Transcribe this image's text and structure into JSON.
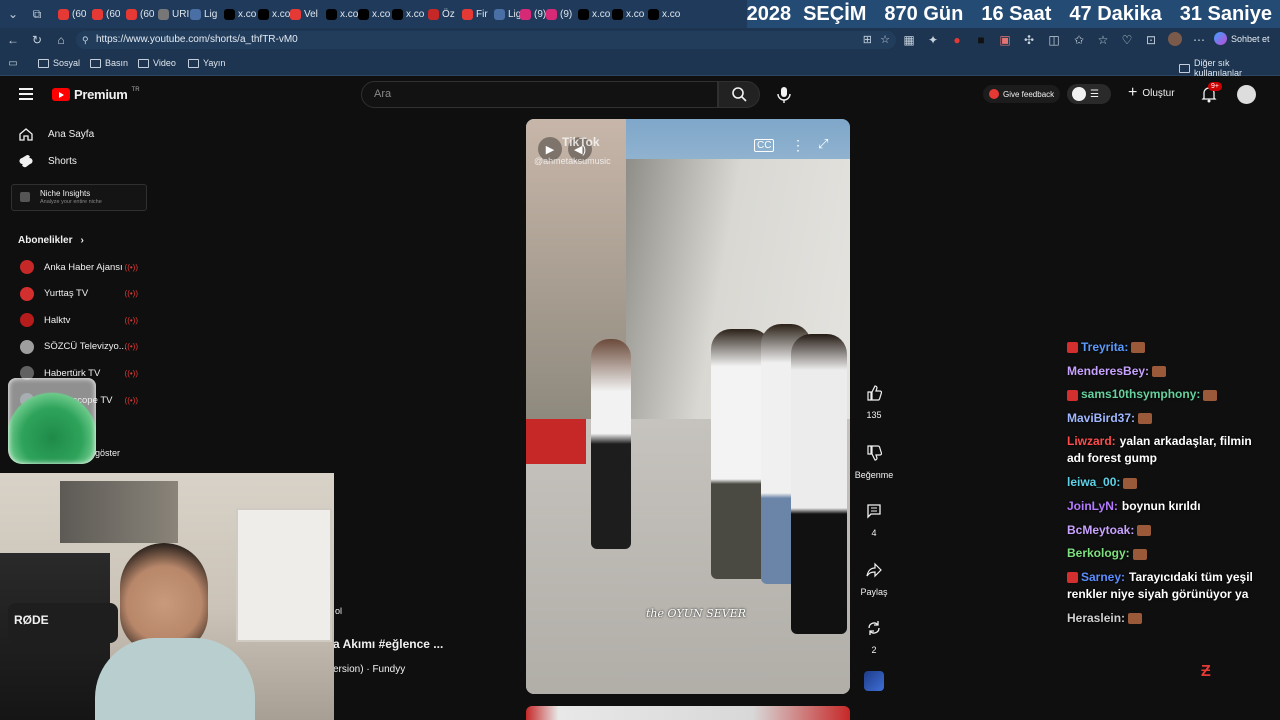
{
  "browser": {
    "tabs": [
      {
        "label": "(60",
        "icon": "youtube-icon",
        "color": "#e53935"
      },
      {
        "label": "(60",
        "icon": "youtube-icon",
        "color": "#e53935"
      },
      {
        "label": "(60",
        "icon": "youtube-icon",
        "color": "#e53935"
      },
      {
        "label": "URI",
        "icon": "generic-icon",
        "color": "#777777"
      },
      {
        "label": "Lig",
        "icon": "slash-icon",
        "color": "#4a6fa5"
      },
      {
        "label": "x.co",
        "icon": "x-icon",
        "color": "#000000"
      },
      {
        "label": "x.co",
        "icon": "x-icon",
        "color": "#000000"
      },
      {
        "label": "Vel",
        "icon": "youtube-icon",
        "color": "#e53935"
      },
      {
        "label": "x.co",
        "icon": "x-icon",
        "color": "#000000"
      },
      {
        "label": "x.co",
        "icon": "x-icon",
        "color": "#000000"
      },
      {
        "label": "x.co",
        "icon": "x-icon",
        "color": "#000000"
      },
      {
        "label": "Öz",
        "icon": "flag-icon",
        "color": "#c62828"
      },
      {
        "label": "Fir",
        "icon": "youtube-icon",
        "color": "#e53935"
      },
      {
        "label": "Lig",
        "icon": "slash-icon",
        "color": "#4a6fa5"
      },
      {
        "label": "(9)",
        "icon": "instagram-icon",
        "color": "#d62976"
      },
      {
        "label": "(9)",
        "icon": "instagram-icon",
        "color": "#d62976"
      },
      {
        "label": "x.co",
        "icon": "x-icon",
        "color": "#000000"
      },
      {
        "label": "x.co",
        "icon": "x-icon",
        "color": "#000000"
      },
      {
        "label": "x.co",
        "icon": "x-icon",
        "color": "#000000"
      }
    ],
    "countdown": {
      "year": "2028",
      "title": "SEÇİM",
      "days": "870 Gün",
      "hours": "16 Saat",
      "minutes": "47 Dakika",
      "seconds": "31 Saniye"
    },
    "url": "https://www.youtube.com/shorts/a_thfTR-vM0",
    "chat_button": "Sohbet et",
    "bookmarks": [
      "Sosyal",
      "Basın",
      "Video",
      "Yayın"
    ],
    "other_bookmarks": "Diğer sık kullanılanlar"
  },
  "youtube": {
    "logo": "Premium",
    "logo_region": "TR",
    "search_placeholder": "Ara",
    "feedback": "Give feedback",
    "create": "Oluştur",
    "notif_count": "9+",
    "sidebar": {
      "home": "Ana Sayfa",
      "shorts": "Shorts",
      "niche_title": "Niche Insights",
      "niche_sub": "Analyze your entire niche",
      "subs_heading": "Abonelikler",
      "channels": [
        {
          "name": "Anka Haber Ajansı",
          "color": "#c62828"
        },
        {
          "name": "Yurttaş TV",
          "color": "#d32f2f"
        },
        {
          "name": "Halktv",
          "color": "#b71c1c"
        },
        {
          "name": "SÖZCÜ Televizyo...",
          "color": "#9e9e9e"
        },
        {
          "name": "Habertürk TV",
          "color": "#616161"
        },
        {
          "name": "Medyascope TV",
          "color": "#455a64"
        }
      ],
      "show_more": "göster"
    },
    "video": {
      "watermark": "TikTok",
      "watermark_user": "@ahmetaksumusic",
      "caption": "the OYUN SEVER"
    },
    "actions": {
      "likes": "135",
      "dislike": "Beğenme",
      "comments": "4",
      "share": "Paylaş",
      "remix": "2"
    },
    "left_overlay": {
      "line1": "ol",
      "title": "a Akımı #eğlence ...",
      "music": "ersion) · Fundyy"
    }
  },
  "chat": [
    {
      "user": "Treyrita:",
      "color": "#5b9bff",
      "text": "",
      "badge": true
    },
    {
      "user": "MenderesBey:",
      "color": "#c8a2ff",
      "text": "",
      "badge": false
    },
    {
      "user": "sams10thsymphony:",
      "color": "#66d19e",
      "text": "",
      "badge": true
    },
    {
      "user": "MaviBird37:",
      "color": "#9fb8ff",
      "text": "",
      "badge": false
    },
    {
      "user": "Liwzard:",
      "color": "#ff4d4d",
      "text": "yalan arkadaşlar, filmin adı forest gump",
      "badge": false
    },
    {
      "user": "leiwa_00:",
      "color": "#5fd1e8",
      "text": "",
      "badge": false
    },
    {
      "user": "JoinLyN:",
      "color": "#b57bff",
      "text": "boynun kırıldı",
      "badge": false
    },
    {
      "user": "BcMeytoak:",
      "color": "#c9a2ff",
      "text": "",
      "badge": false
    },
    {
      "user": "Berkology:",
      "color": "#7ee07e",
      "text": "",
      "badge": false
    },
    {
      "user": "Sarney:",
      "color": "#5b8dff",
      "text": "Tarayıcıdaki tüm yeşil renkler niye siyah görünüyor ya",
      "badge": true
    },
    {
      "user": "Heraslein:",
      "color": "#cfcfcf",
      "text": "",
      "badge": false
    }
  ],
  "webcam": {
    "mic_brand": "RØDE"
  }
}
